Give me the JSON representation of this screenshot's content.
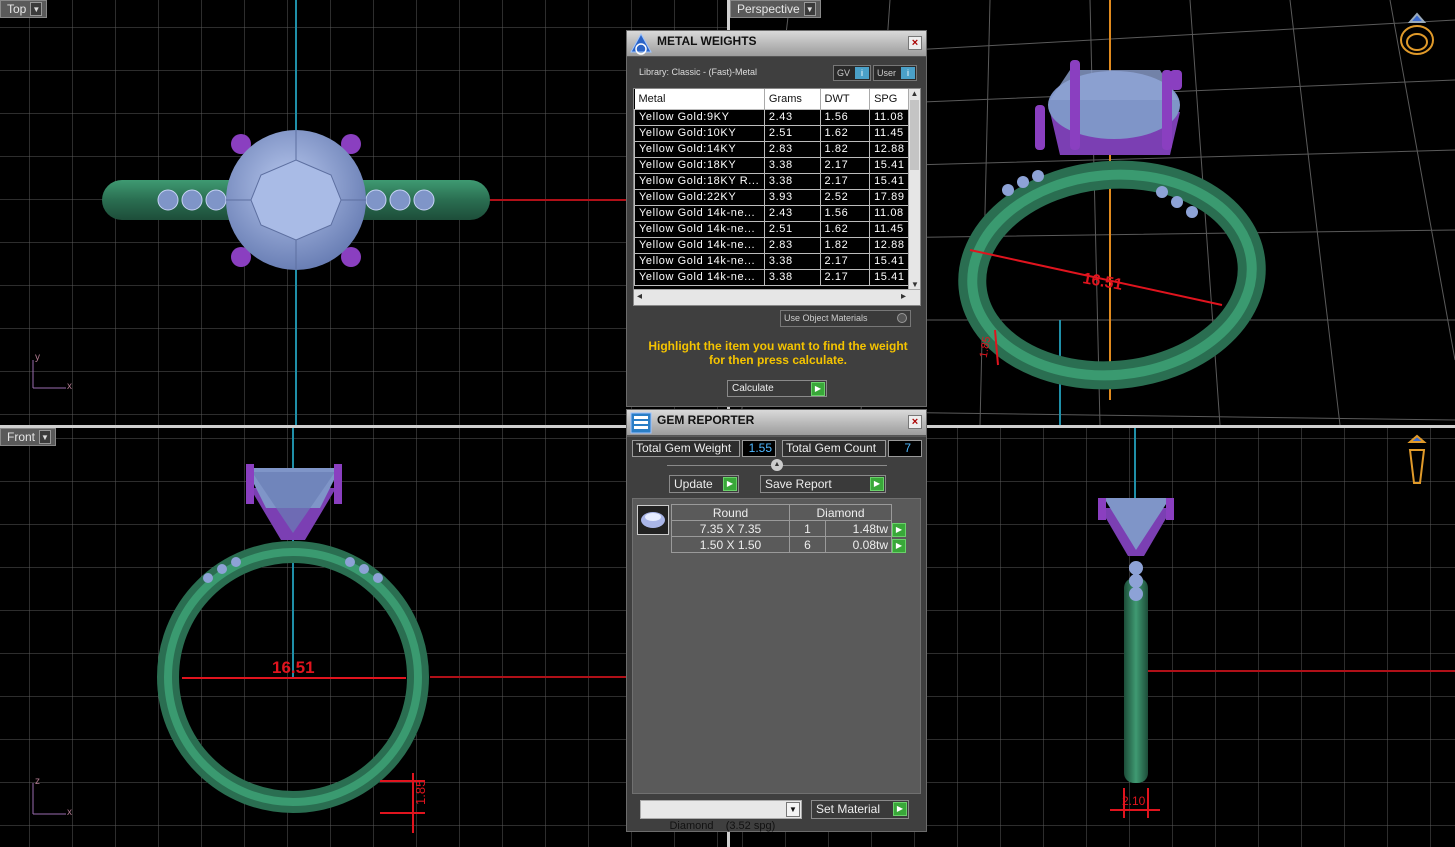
{
  "viewports": {
    "top": {
      "label": "Top",
      "axis_a": "x",
      "axis_b": "y"
    },
    "perspective": {
      "label": "Perspective"
    },
    "front": {
      "label": "Front",
      "axis_a": "x",
      "axis_b": "z",
      "dim_width": "16.51",
      "dim_height": "1.85"
    },
    "right": {
      "dim_width": "2.10"
    },
    "perspective_dims": {
      "dim_width": "16.51",
      "dim_height": "1.85"
    }
  },
  "metal_weights": {
    "title": "METAL WEIGHTS",
    "library": "Library: Classic - (Fast)-Metal",
    "gv_label": "GV",
    "user_label": "User",
    "columns": [
      "Metal",
      "Grams",
      "DWT",
      "SPG"
    ],
    "rows": [
      [
        "Yellow Gold:9KY",
        "2.43",
        "1.56",
        "11.08"
      ],
      [
        "Yellow Gold:10KY",
        "2.51",
        "1.62",
        "11.45"
      ],
      [
        "Yellow Gold:14KY",
        "2.83",
        "1.82",
        "12.88"
      ],
      [
        "Yellow Gold:18KY",
        "3.38",
        "2.17",
        "15.41"
      ],
      [
        "Yellow Gold:18KY R...",
        "3.38",
        "2.17",
        "15.41"
      ],
      [
        "Yellow Gold:22KY",
        "3.93",
        "2.52",
        "17.89"
      ],
      [
        "Yellow Gold 14k-ne...",
        "2.43",
        "1.56",
        "11.08"
      ],
      [
        "Yellow Gold 14k-ne...",
        "2.51",
        "1.62",
        "11.45"
      ],
      [
        "Yellow Gold 14k-ne...",
        "2.83",
        "1.82",
        "12.88"
      ],
      [
        "Yellow Gold 14k-ne...",
        "3.38",
        "2.17",
        "15.41"
      ],
      [
        "Yellow Gold 14k-ne...",
        "3.38",
        "2.17",
        "15.41"
      ]
    ],
    "use_object_materials": "Use Object Materials",
    "hint": "Highlight the item you want to find the weight for then press calculate.",
    "calculate_label": "Calculate"
  },
  "gem_reporter": {
    "title": "GEM REPORTER",
    "total_weight_label": "Total Gem Weight",
    "total_weight": "1.55",
    "total_count_label": "Total Gem Count",
    "total_count": "7",
    "update_label": "Update",
    "save_report_label": "Save Report",
    "shape": "Round",
    "material": "Diamond",
    "gems": [
      {
        "size": "7.35 X 7.35",
        "count": "1",
        "weight": "1.48tw"
      },
      {
        "size": "1.50 X 1.50",
        "count": "6",
        "weight": "0.08tw"
      }
    ],
    "material_select": "Diamond    (3.52 spg)",
    "set_material_label": "Set Material"
  },
  "colors": {
    "band": "#2f7a5a",
    "prong": "#7a3fb0",
    "gem": "#7f95c8",
    "dimension": "#e0141e",
    "highlight_text": "#f5c400"
  }
}
